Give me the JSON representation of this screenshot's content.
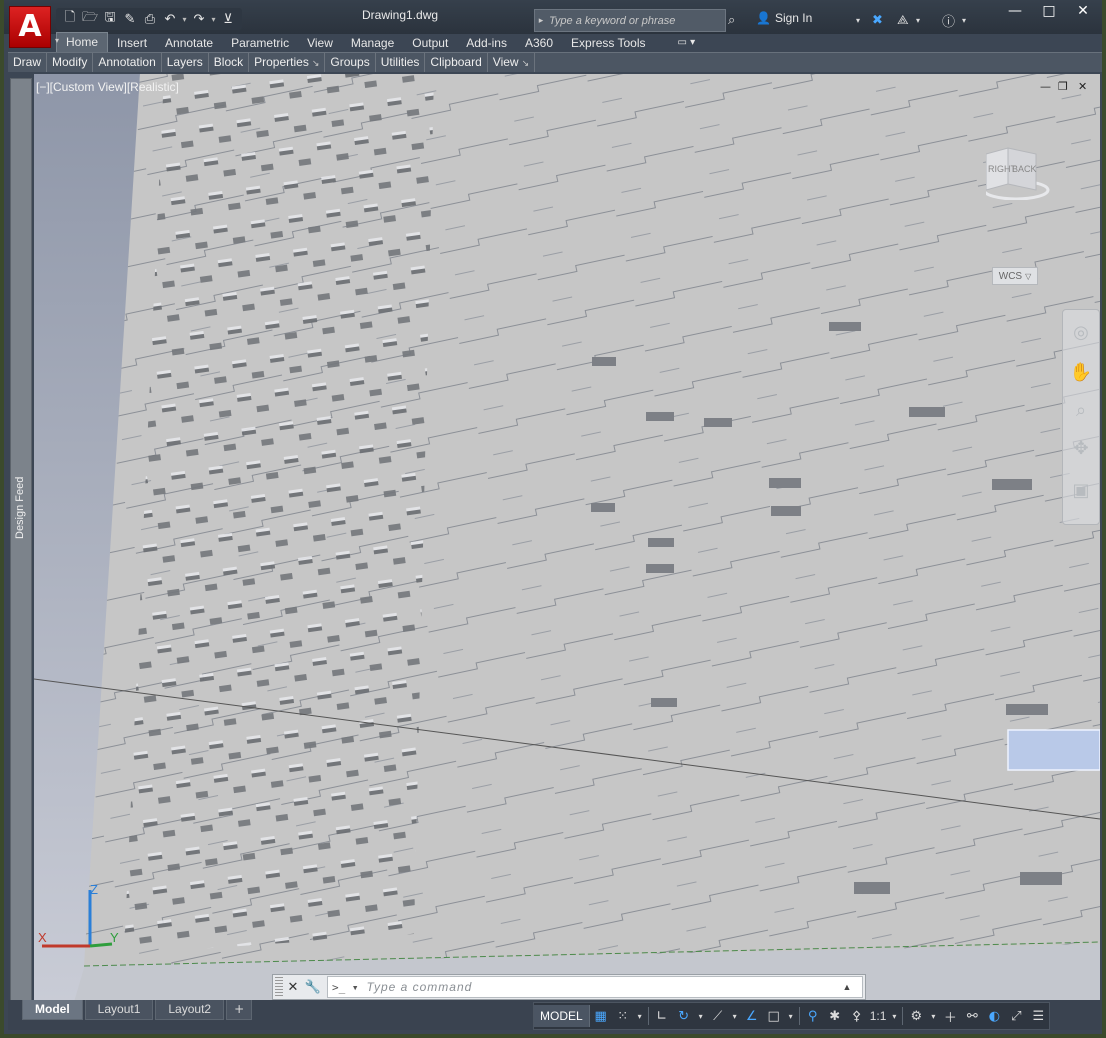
{
  "window": {
    "document_title": "Drawing1.dwg",
    "controls": {
      "minimize": "—",
      "maximize": "□",
      "close": "✕"
    }
  },
  "app_menu": {
    "logo_letter": "A"
  },
  "quick_access": {
    "icons": [
      "new-icon",
      "open-icon",
      "save-icon",
      "save-as-icon",
      "plot-icon",
      "undo-icon",
      "redo-icon",
      "customize-icon"
    ]
  },
  "search": {
    "placeholder": "Type a keyword or phrase"
  },
  "account": {
    "sign_in": "Sign In"
  },
  "ribbon": {
    "tabs": [
      "Home",
      "Insert",
      "Annotate",
      "Parametric",
      "View",
      "Manage",
      "Output",
      "Add-ins",
      "A360",
      "Express Tools"
    ],
    "active_tab": "Home",
    "panels": [
      "Draw",
      "Modify",
      "Annotation",
      "Layers",
      "Block",
      "Properties",
      "Groups",
      "Utilities",
      "Clipboard",
      "View"
    ],
    "expandable_panels": [
      "Properties",
      "View"
    ]
  },
  "design_feed": {
    "label": "Design Feed"
  },
  "viewport": {
    "label": "[−][Custom View][Realistic]",
    "viewcube": {
      "right": "RIGHT",
      "back": "BACK"
    },
    "wcs": "WCS",
    "ucs": {
      "x": "X",
      "y": "Y",
      "z": "Z"
    }
  },
  "command_line": {
    "placeholder": "Type a command"
  },
  "layout_tabs": [
    "Model",
    "Layout1",
    "Layout2"
  ],
  "active_layout": "Model",
  "status_bar": {
    "model": "MODEL",
    "scale": "1:1"
  },
  "colors": {
    "accent": "#4aa8ff",
    "brand_red": "#cc1111",
    "viewport_bg": "#c4c7ce"
  }
}
